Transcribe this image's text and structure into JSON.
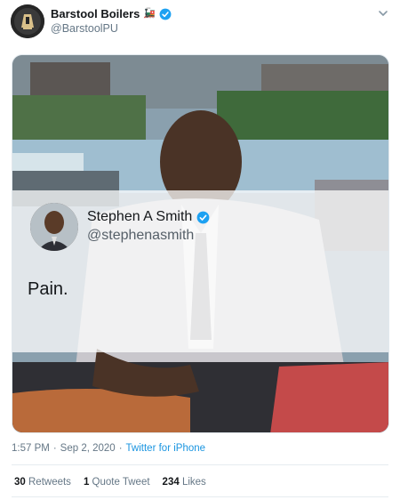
{
  "author": {
    "display_name": "Barstool Boilers",
    "flag_emoji": "🚂",
    "handle": "@BarstoolPU",
    "verified": true
  },
  "quoted": {
    "name": "Stephen A Smith",
    "handle": "@stephenasmith",
    "text": "Pain.",
    "verified": true
  },
  "meta": {
    "time": "1:57 PM",
    "sep1": "·",
    "date": "Sep 2, 2020",
    "sep2": "·",
    "source": "Twitter for iPhone"
  },
  "stats": {
    "retweets_count": "30",
    "retweets_label": "Retweets",
    "quotes_count": "1",
    "quotes_label": "Quote Tweet",
    "likes_count": "234",
    "likes_label": "Likes"
  },
  "colors": {
    "verified_blue": "#1da1f2",
    "link_blue": "#1b95e0",
    "muted": "#657786"
  }
}
